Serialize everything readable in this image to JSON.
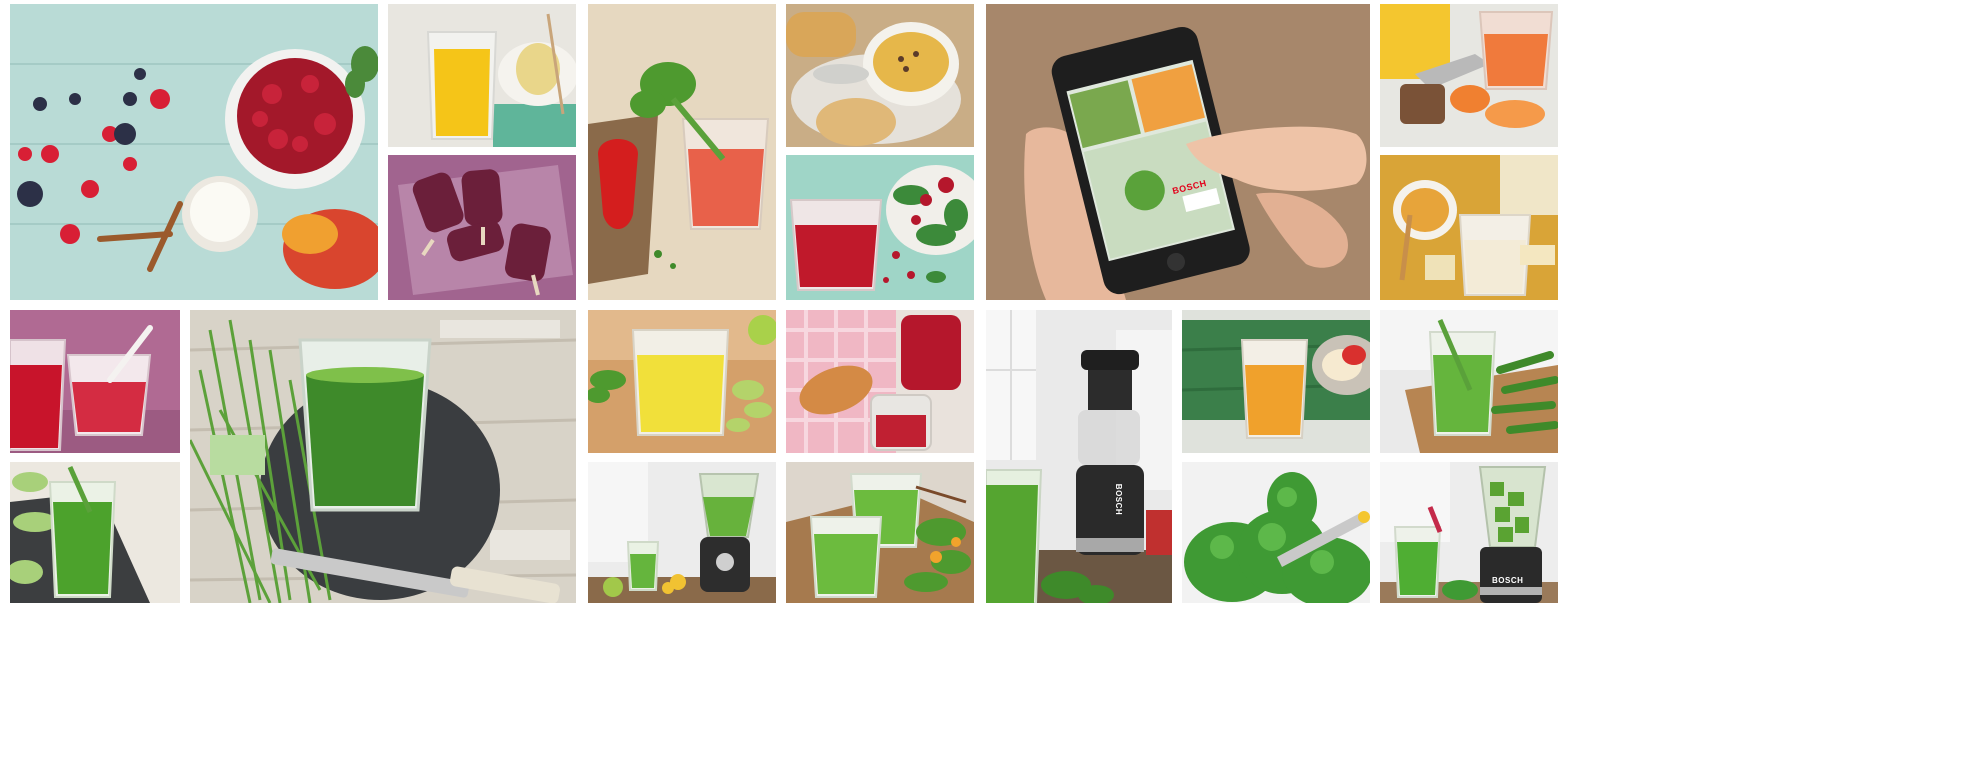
{
  "collage": {
    "brand_text": "BOSCH",
    "tiles": [
      {
        "id": "berries-yogurt-mango",
        "subject": "berries, yogurt, cinnamon and mango on a light blue table"
      },
      {
        "id": "yellow-juice-pear",
        "subject": "glass of yellow juice with pear"
      },
      {
        "id": "berry-popsicles",
        "subject": "berry popsicles on a glass plate"
      },
      {
        "id": "red-juice-pepper-celery",
        "subject": "glass of red juice with pepper and celery"
      },
      {
        "id": "soup-bread",
        "subject": "bowl of soup with bread"
      },
      {
        "id": "red-smoothie-pomegranate",
        "subject": "red smoothie with pomegranate salad"
      },
      {
        "id": "phone-app",
        "subject": "hand holding a smartphone with recipe app"
      },
      {
        "id": "orange-smoothie-papaya",
        "subject": "orange smoothie with papaya and knife"
      },
      {
        "id": "honey-drink",
        "subject": "honey and a milky drink"
      },
      {
        "id": "berry-smoothie-spoon",
        "subject": "berry smoothie glasses with spoon"
      },
      {
        "id": "wheatgrass-juice",
        "subject": "green wheatgrass juice on slate"
      },
      {
        "id": "lemon-juice",
        "subject": "yellow lemon juice with lime"
      },
      {
        "id": "jam-croissant",
        "subject": "jam jars with croissant"
      },
      {
        "id": "slow-juicer",
        "subject": "slow juicer with green juice"
      },
      {
        "id": "orange-juice-apples",
        "subject": "orange juice with apples"
      },
      {
        "id": "green-juice-cutting-board",
        "subject": "green juice on a cutting board"
      },
      {
        "id": "cucumber-juice",
        "subject": "cucumber green juice"
      },
      {
        "id": "blender-green",
        "subject": "blender with green smoothie"
      },
      {
        "id": "green-smoothies-salad",
        "subject": "green smoothies with salad"
      },
      {
        "id": "kale",
        "subject": "kale leaves"
      },
      {
        "id": "blender-green-2",
        "subject": "blender with green smoothie and glass"
      }
    ]
  }
}
